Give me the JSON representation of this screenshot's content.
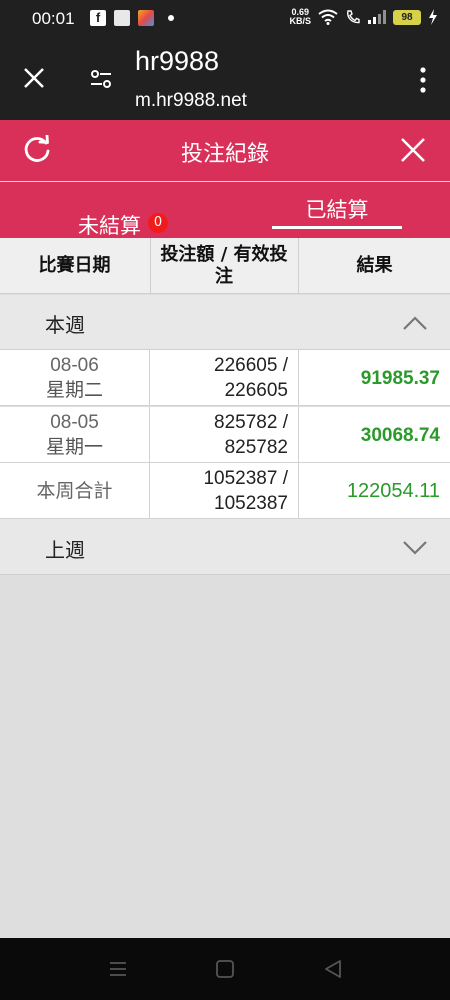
{
  "status_bar": {
    "time": "00:01",
    "speed_value": "0.69",
    "speed_unit": "KB/S",
    "battery": "98",
    "icons": [
      "facebook-icon",
      "app-icon",
      "app2-icon",
      "dot-icon",
      "wifi-icon",
      "call-icon",
      "signal-icon",
      "battery-icon",
      "charging-icon"
    ]
  },
  "browser": {
    "title": "hr9988",
    "url": "m.hr9988.net"
  },
  "header": {
    "title": "投注紀錄"
  },
  "tabs": {
    "unsettled": "未結算",
    "unsettled_count": "0",
    "settled": "已結算"
  },
  "table": {
    "headers": {
      "date": "比賽日期",
      "bet": "投注額 / 有效投注",
      "result": "結果"
    },
    "this_week": {
      "label": "本週",
      "rows": [
        {
          "date": "08-06",
          "weekday": "星期二",
          "bet": "226605 / 226605",
          "result": "91985.37"
        },
        {
          "date": "08-05",
          "weekday": "星期一",
          "bet": "825782 / 825782",
          "result": "30068.74"
        }
      ],
      "total": {
        "label": "本周合計",
        "bet": "1052387 / 1052387",
        "result": "122054.11"
      }
    },
    "last_week": {
      "label": "上週"
    }
  },
  "colors": {
    "accent": "#d9305a",
    "positive": "#2a9a2a",
    "badge": "#f21b1b"
  }
}
